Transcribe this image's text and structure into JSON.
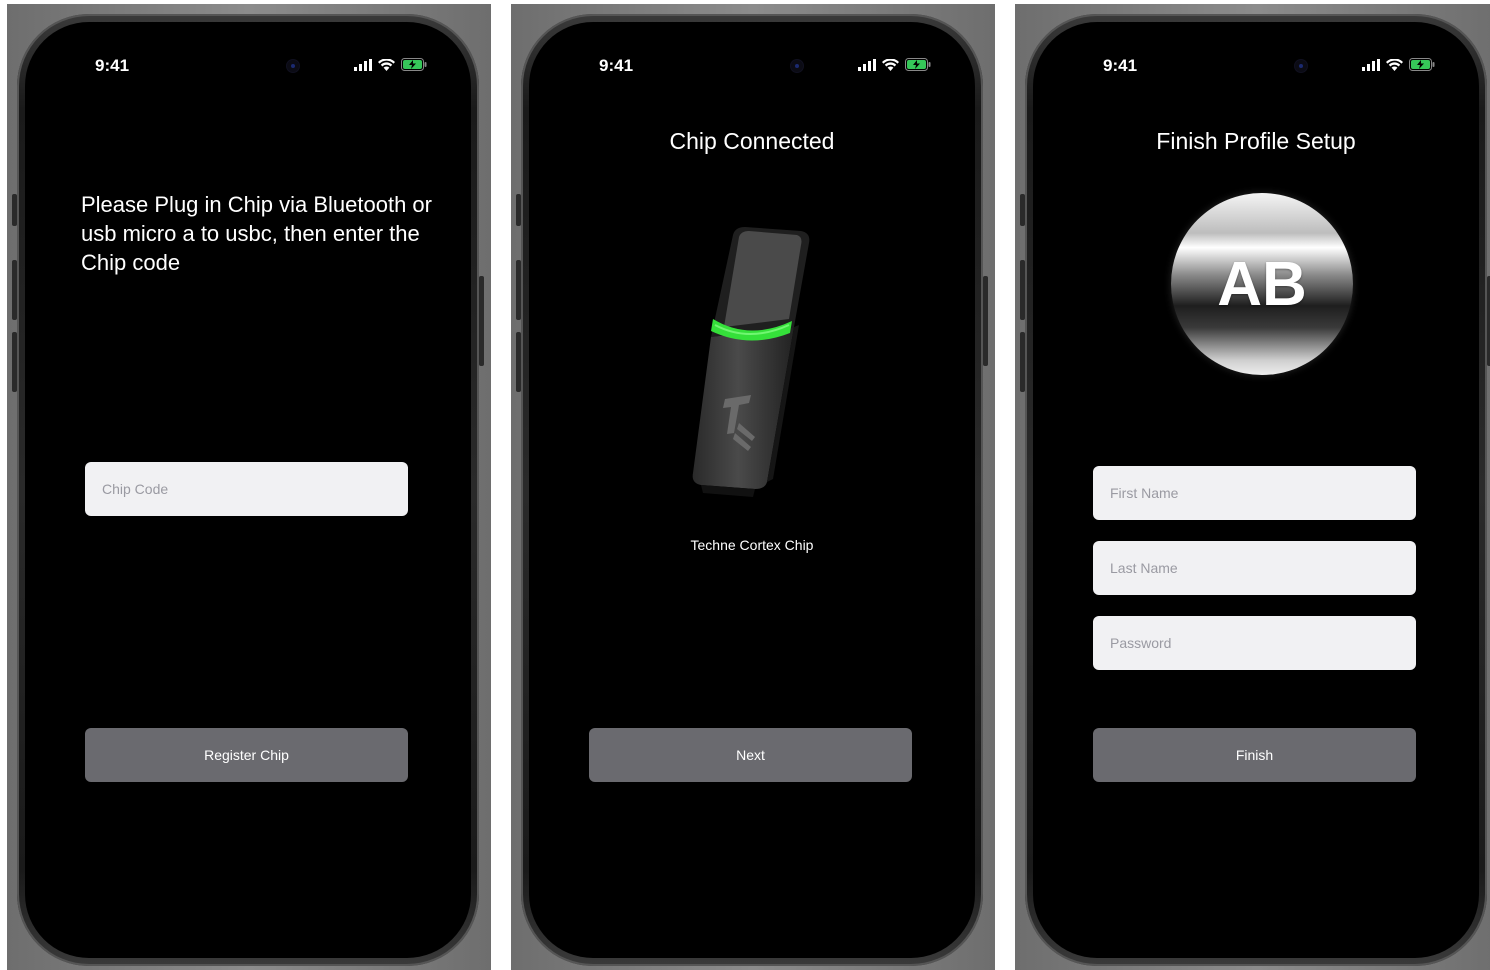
{
  "status_bar": {
    "time": "9:41",
    "signal_icon": "signal-icon",
    "wifi_icon": "wifi-icon",
    "battery_icon": "battery-charging-icon",
    "battery_color": "#36c759"
  },
  "screen1": {
    "instruction": "Please Plug in Chip via Bluetooth or usb micro a to usbc, then enter the Chip code",
    "chip_code_placeholder": "Chip Code",
    "register_button": "Register Chip"
  },
  "screen2": {
    "title": "Chip Connected",
    "chip_caption": "Techne Cortex Chip",
    "next_button": "Next",
    "accent": "#35e03a"
  },
  "screen3": {
    "title": "Finish Profile Setup",
    "avatar_initials": "AB",
    "first_name_placeholder": "First Name",
    "last_name_placeholder": "Last Name",
    "password_placeholder": "Password",
    "finish_button": "Finish"
  },
  "colors": {
    "screen_bg": "#000000",
    "button_bg": "#6a6a6f",
    "input_bg": "#f1f1f3"
  }
}
